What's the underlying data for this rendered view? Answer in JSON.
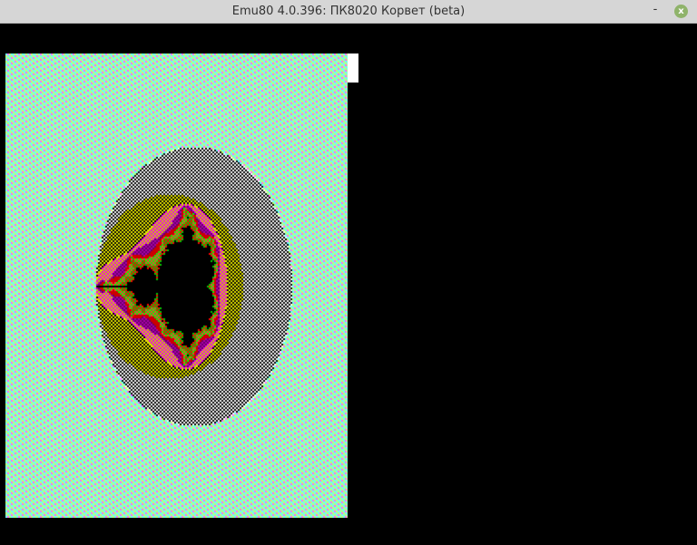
{
  "window": {
    "title": "Emu80 4.0.396: ПК8020 Корвет (beta)",
    "minimize_label": "-",
    "close_label": "x"
  },
  "colors": {
    "titlebar": "#d6d6d6",
    "close_button": "#8fb36a",
    "screen": "#000000"
  }
}
